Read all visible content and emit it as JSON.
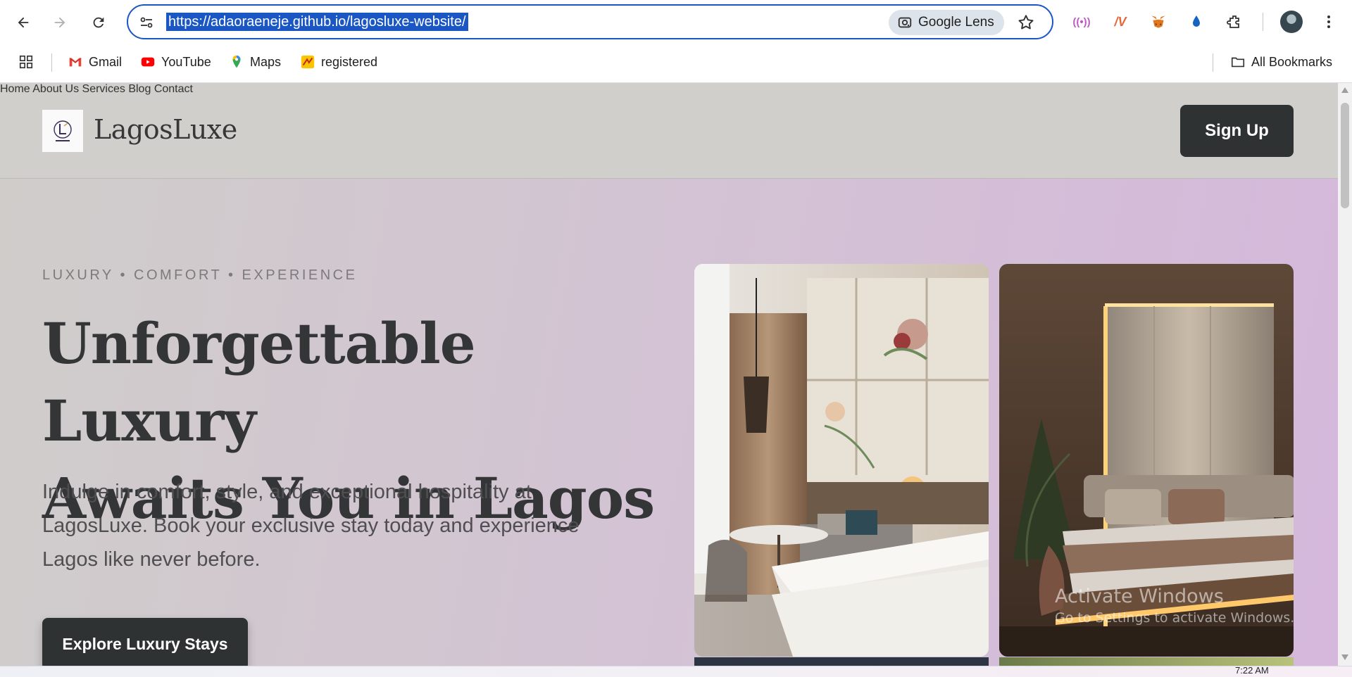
{
  "browser": {
    "url": "https://adaoraeneje.github.io/lagosluxe-website/",
    "lens_label": "Google Lens",
    "icons": [
      "back-arrow-icon",
      "forward-arrow-icon",
      "reload-icon",
      "site-settings-icon",
      "star-icon",
      "extensions-icon",
      "more-menu-icon"
    ]
  },
  "bookmarks": {
    "items": [
      {
        "label": "Gmail",
        "icon": "gmail-icon"
      },
      {
        "label": "YouTube",
        "icon": "youtube-icon"
      },
      {
        "label": "Maps",
        "icon": "maps-icon"
      },
      {
        "label": "registered",
        "icon": "registered-icon"
      }
    ],
    "all_label": "All Bookmarks"
  },
  "site": {
    "brand": "LagosLuxe",
    "nav": [
      "Home",
      "About Us",
      "Services",
      "Blog",
      "Contact"
    ],
    "signup_label": "Sign Up"
  },
  "hero": {
    "tagline": "LUXURY • COMFORT • EXPERIENCE",
    "title_line1": "Unforgettable Luxury",
    "title_line2": "Awaits You in Lagos",
    "description": "Indulge in comfort, style, and exceptional hospitality at LagosLuxe. Book your exclusive stay today and experience Lagos like never before.",
    "cta_label": "Explore Luxury Stays"
  },
  "watermark": {
    "line1": "Activate Windows",
    "line2": "Go to Settings to activate Windows."
  },
  "taskbar": {
    "clock": "7:22 AM"
  },
  "colors": {
    "accent_blue": "#1a57c4",
    "dark_button": "#2f3232",
    "header_bg": "#d0cfcc",
    "hero_gradient_end": "#d5b8dc"
  }
}
